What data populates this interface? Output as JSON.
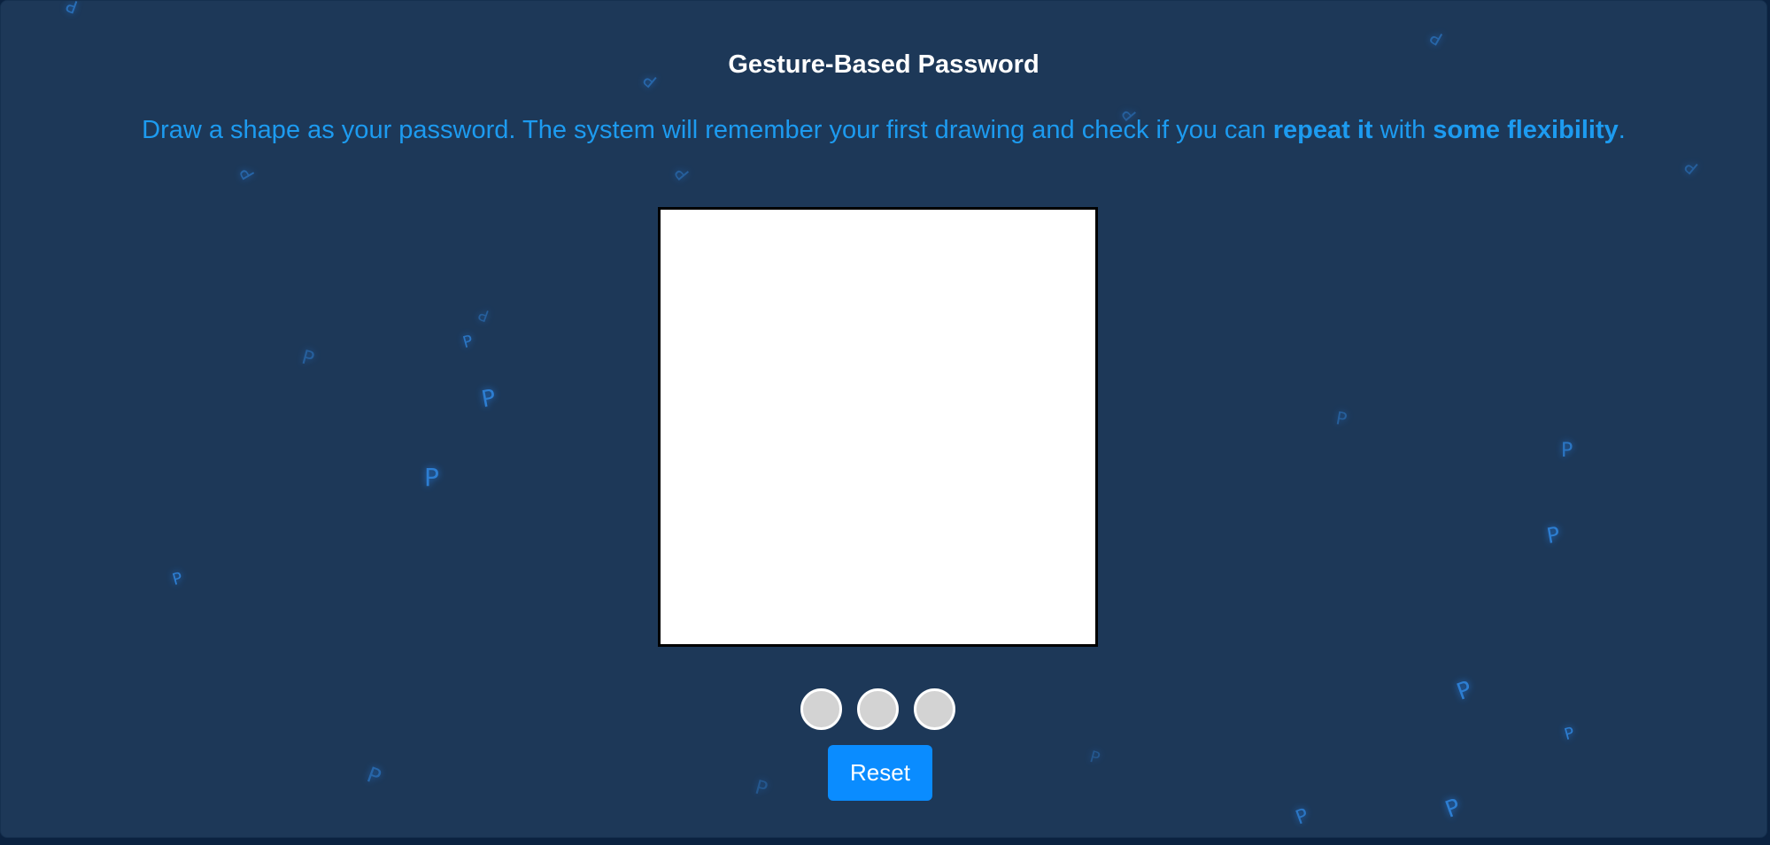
{
  "page": {
    "title": "Gesture-Based Password",
    "instructions": {
      "part1": "Draw a shape as your password. The system will remember your first drawing and check if you can ",
      "bold1": "repeat it",
      "part2": " with ",
      "bold2": "some flexibility",
      "part3": "."
    }
  },
  "canvas": {
    "label": "drawing-canvas"
  },
  "attempts": [
    {
      "state": "empty"
    },
    {
      "state": "empty"
    },
    {
      "state": "empty"
    }
  ],
  "controls": {
    "reset_label": "Reset"
  },
  "decoration": {
    "glyph": "P",
    "color": "#2f86e0"
  },
  "colors": {
    "background": "#1d3858",
    "accent": "#1d9bf0",
    "button": "#0a8cff",
    "dot": "#d3d3d3"
  }
}
